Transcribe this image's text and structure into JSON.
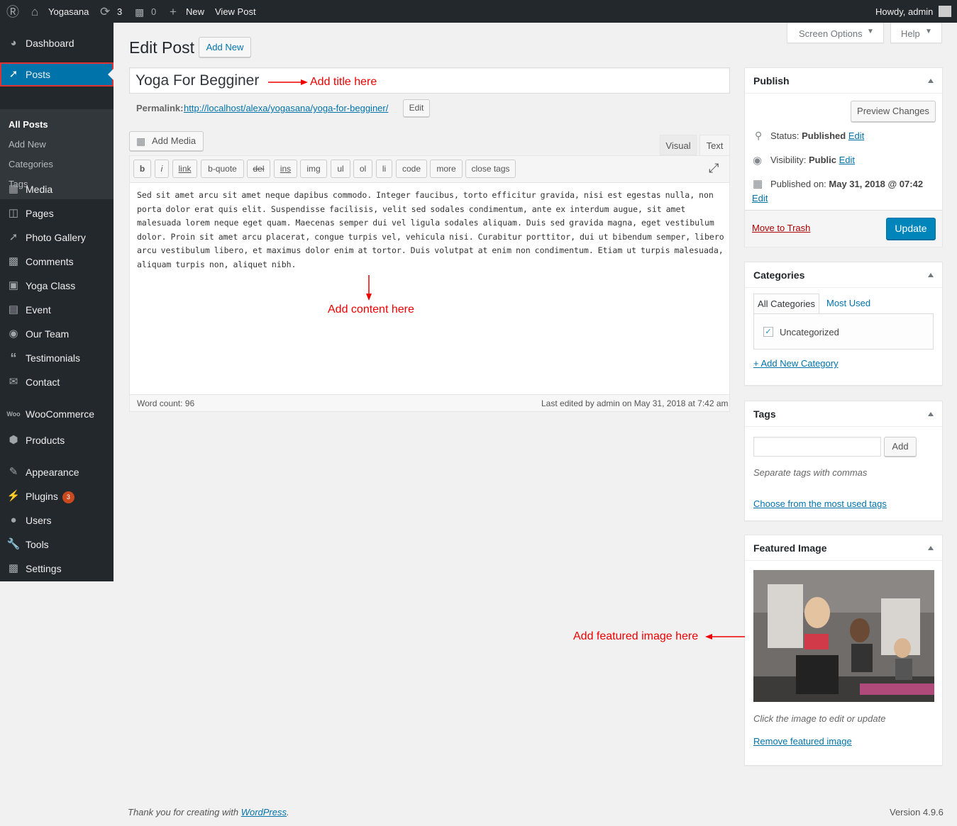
{
  "adminbar": {
    "site_name": "Yogasana",
    "updates_count": "3",
    "comments_count": "0",
    "new_label": "New",
    "view_post_label": "View Post",
    "howdy": "Howdy, admin"
  },
  "sidebar": {
    "items": [
      {
        "label": "Dashboard",
        "icon": "dashboard-icon"
      },
      {
        "label": "Posts",
        "icon": "pin-icon"
      },
      {
        "label": "Media",
        "icon": "media-icon"
      },
      {
        "label": "Pages",
        "icon": "pages-icon"
      },
      {
        "label": "Photo Gallery",
        "icon": "pin-icon"
      },
      {
        "label": "Comments",
        "icon": "comment-icon"
      },
      {
        "label": "Yoga Class",
        "icon": "image-icon"
      },
      {
        "label": "Event",
        "icon": "event-icon"
      },
      {
        "label": "Our Team",
        "icon": "team-icon"
      },
      {
        "label": "Testimonials",
        "icon": "quote-icon"
      },
      {
        "label": "Contact",
        "icon": "mail-icon"
      },
      {
        "label": "WooCommerce",
        "icon": "woo-icon"
      },
      {
        "label": "Products",
        "icon": "box-icon"
      },
      {
        "label": "Appearance",
        "icon": "brush-icon"
      },
      {
        "label": "Plugins",
        "icon": "plug-icon",
        "badge": "3"
      },
      {
        "label": "Users",
        "icon": "user-icon"
      },
      {
        "label": "Tools",
        "icon": "wrench-icon"
      },
      {
        "label": "Settings",
        "icon": "settings-icon"
      }
    ],
    "submenu": [
      "All Posts",
      "Add New",
      "Categories",
      "Tags"
    ]
  },
  "header": {
    "title": "Edit Post",
    "add_new": "Add New",
    "screen_options": "Screen Options",
    "help": "Help"
  },
  "post": {
    "title": "Yoga For Begginer",
    "permalink_label": "Permalink:",
    "permalink_url": "http://localhost/alexa/yogasana/yoga-for-begginer/",
    "permalink_edit": "Edit"
  },
  "editor": {
    "add_media": "Add Media",
    "tab_visual": "Visual",
    "tab_text": "Text",
    "quicktags": [
      "b",
      "i",
      "link",
      "b-quote",
      "del",
      "ins",
      "img",
      "ul",
      "ol",
      "li",
      "code",
      "more",
      "close tags"
    ],
    "content": "Sed sit amet arcu sit amet neque dapibus commodo. Integer faucibus, torto efficitur gravida, nisi est egestas nulla, non porta dolor erat quis elit. Suspendisse facilisis, velit sed sodales condimentum, ante ex interdum augue, sit amet malesuada lorem neque eget quam. Maecenas semper dui vel ligula sodales aliquam. Duis sed gravida magna, eget vestibulum dolor. Proin sit amet arcu placerat, congue turpis vel, vehicula nisi. Curabitur porttitor, dui ut bibendum semper, libero arcu vestibulum libero, et maximus dolor enim at tortor. Duis volutpat at enim non condimentum. Etiam ut turpis malesuada, aliquam turpis non, aliquet nibh.",
    "word_count": "Word count: 96",
    "last_edited": "Last edited by admin on May 31, 2018 at 7:42 am"
  },
  "annotations": {
    "title": "Add title here",
    "content": "Add content here",
    "featured": "Add featured image here"
  },
  "publish": {
    "heading": "Publish",
    "preview": "Preview Changes",
    "status_label": "Status:",
    "status_value": "Published",
    "status_edit": "Edit",
    "visibility_label": "Visibility:",
    "visibility_value": "Public",
    "visibility_edit": "Edit",
    "published_label": "Published on:",
    "published_value": "May 31, 2018 @ 07:42",
    "published_edit": "Edit",
    "trash": "Move to Trash",
    "update": "Update"
  },
  "categories": {
    "heading": "Categories",
    "tab_all": "All Categories",
    "tab_most": "Most Used",
    "item": "Uncategorized",
    "checkmark": "✓",
    "add_new": "+ Add New Category"
  },
  "tags": {
    "heading": "Tags",
    "add": "Add",
    "input_value": "",
    "hint": "Separate tags with commas",
    "choose": "Choose from the most used tags"
  },
  "featured": {
    "heading": "Featured Image",
    "hint": "Click the image to edit or update",
    "remove": "Remove featured image"
  },
  "footer": {
    "thanks_prefix": "Thank you for creating with ",
    "wordpress": "WordPress",
    "thanks_suffix": ".",
    "version": "Version 4.9.6"
  },
  "colors": {
    "accent": "#0073aa",
    "sidebar_bg": "#23282d",
    "annotation": "#ee0000"
  }
}
